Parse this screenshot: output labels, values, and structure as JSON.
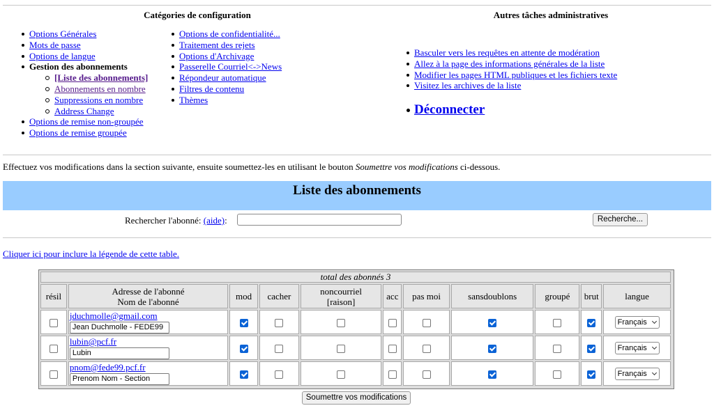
{
  "config": {
    "title": "Catégories de configuration",
    "menu_a": [
      {
        "label": "Options Générales"
      },
      {
        "label": "Mots de passe"
      },
      {
        "label": "Options de langue"
      },
      {
        "label": "Gestion des abonnements"
      }
    ],
    "submenu": [
      {
        "label": "[Liste des abonnements]"
      },
      {
        "label": "Abonnements en nombre"
      },
      {
        "label": "Suppressions en nombre"
      },
      {
        "label": "Address Change"
      }
    ],
    "menu_a_tail": [
      {
        "label": "Options de remise non-groupée"
      },
      {
        "label": "Options de remise groupée"
      }
    ],
    "menu_b": [
      {
        "label": "Options de confidentialité..."
      },
      {
        "label": "Traitement des rejets"
      },
      {
        "label": "Options d'Archivage"
      },
      {
        "label": "Passerelle Courriel<->News"
      },
      {
        "label": "Répondeur automatique"
      },
      {
        "label": "Filtres de contenu"
      },
      {
        "label": "Thèmes"
      }
    ]
  },
  "admin": {
    "title": "Autres tâches administratives",
    "links": [
      {
        "label": "Basculer vers les requêtes en attente de modération"
      },
      {
        "label": "Allez à la page des informations générales de la liste"
      },
      {
        "label": "Modifier les pages HTML publiques et les fichiers texte"
      },
      {
        "label": "Visitez les archives de la liste"
      }
    ],
    "logout": "Déconnecter"
  },
  "instructions": {
    "before": "Effectuez vos modifications dans la section suivante, ensuite soumettez-les en utilisant le bouton ",
    "emph": "Soumettre vos modifications",
    "after": " ci-dessous."
  },
  "banner_title": "Liste des abonnements",
  "search": {
    "label": "Rechercher l'abonné: ",
    "help": "(aide)",
    "colon": ":",
    "value": "",
    "button": "Recherche..."
  },
  "legend_link": "Cliquer ici pour inclure la légende de cette table.",
  "table": {
    "total": "total des abonnés 3",
    "headers": {
      "resil": "résil",
      "addr_line1": "Adresse de l'abonné",
      "addr_line2": "Nom de l'abonné",
      "mod": "mod",
      "cacher": "cacher",
      "noncourriel_line1": "noncourriel",
      "noncourriel_line2": "[raison]",
      "acc": "acc",
      "pasmoi": "pas moi",
      "sansdoublons": "sansdoublons",
      "groupe": "groupé",
      "brut": "brut",
      "langue": "langue"
    },
    "rows": [
      {
        "email": "jduchmolle@gmail.com",
        "name": "Jean Duchmolle - FEDE99",
        "resil": false,
        "mod": true,
        "cacher": false,
        "noncourriel": false,
        "acc": false,
        "pasmoi": false,
        "sansdoublons": true,
        "groupe": false,
        "brut": true,
        "langue": "Français"
      },
      {
        "email": "lubin@pcf.fr",
        "name": "Lubin",
        "resil": false,
        "mod": true,
        "cacher": false,
        "noncourriel": false,
        "acc": false,
        "pasmoi": false,
        "sansdoublons": true,
        "groupe": false,
        "brut": true,
        "langue": "Français"
      },
      {
        "email": "pnom@fede99.pcf.fr",
        "name": "Prenom Nom - Section",
        "resil": false,
        "mod": true,
        "cacher": false,
        "noncourriel": false,
        "acc": false,
        "pasmoi": false,
        "sansdoublons": true,
        "groupe": false,
        "brut": true,
        "langue": "Français"
      }
    ]
  },
  "submit_button": "Soumettre vos modifications"
}
